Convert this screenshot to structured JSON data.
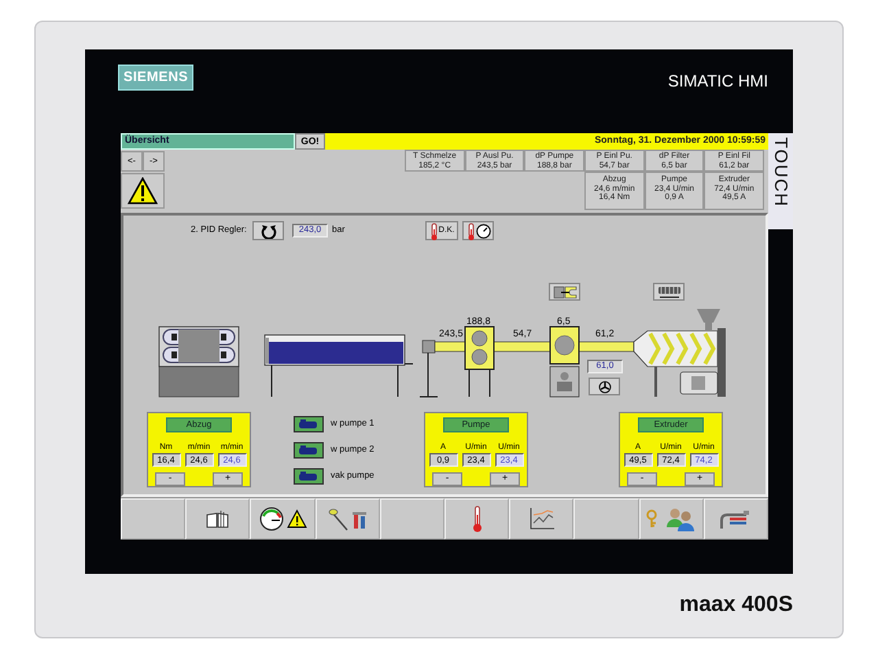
{
  "device": {
    "brand_logo": "SIEMENS",
    "product": "SIMATIC HMI",
    "side_label": "TOUCH",
    "model": "maax 400S"
  },
  "header": {
    "screen_field": "Übersicht",
    "go_button": "GO!",
    "datetime": "Sonntag, 31. Dezember 2000 10:59:59"
  },
  "nav_buttons": [
    "<-",
    "->"
  ],
  "readings": [
    {
      "label": "T Schmelze",
      "value": "185,2 °C"
    },
    {
      "label": "P Ausl Pu.",
      "value": "243,5 bar"
    },
    {
      "label": "dP Pumpe",
      "value": "188,8 bar"
    },
    {
      "label": "P Einl Pu.",
      "value": "54,7 bar"
    },
    {
      "label": "dP Filter",
      "value": "6,5 bar"
    },
    {
      "label": "P Einl Fil",
      "value": "61,2 bar"
    }
  ],
  "drives": [
    {
      "name": "Abzug",
      "lines": [
        "24,6 m/min",
        "16,4 Nm"
      ]
    },
    {
      "name": "Pumpe",
      "lines": [
        "23,4 U/min",
        "0,9 A"
      ]
    },
    {
      "name": "Extruder",
      "lines": [
        "72,4 U/min",
        "49,5 A"
      ]
    }
  ],
  "pid": {
    "label": "2. PID Regler:",
    "value": "243,0",
    "unit": "bar"
  },
  "dk_button": "D.K.",
  "process_values": [
    "243,5",
    "188,8",
    "54,7",
    "6,5",
    "61,2"
  ],
  "filter_field": "61,0",
  "pump_buttons": [
    "w pumpe 1",
    "w pumpe 2",
    "vak pumpe"
  ],
  "panels": [
    {
      "title": "Abzug",
      "columns": [
        {
          "unit": "Nm",
          "value": "16,4",
          "kind": "actual"
        },
        {
          "unit": "m/min",
          "value": "24,6",
          "kind": "actual"
        },
        {
          "unit": "m/min",
          "value": "24,6",
          "kind": "setpoint"
        }
      ],
      "buttons": [
        "-",
        "+"
      ]
    },
    {
      "title": "Pumpe",
      "columns": [
        {
          "unit": "A",
          "value": "0,9",
          "kind": "actual"
        },
        {
          "unit": "U/min",
          "value": "23,4",
          "kind": "actual"
        },
        {
          "unit": "U/min",
          "value": "23,4",
          "kind": "setpoint"
        }
      ],
      "buttons": [
        "-",
        "+"
      ]
    },
    {
      "title": "Extruder",
      "columns": [
        {
          "unit": "A",
          "value": "49,5",
          "kind": "actual"
        },
        {
          "unit": "U/min",
          "value": "72,4",
          "kind": "actual"
        },
        {
          "unit": "U/min",
          "value": "74,2",
          "kind": "setpoint"
        }
      ],
      "buttons": [
        "-",
        "+"
      ]
    }
  ]
}
